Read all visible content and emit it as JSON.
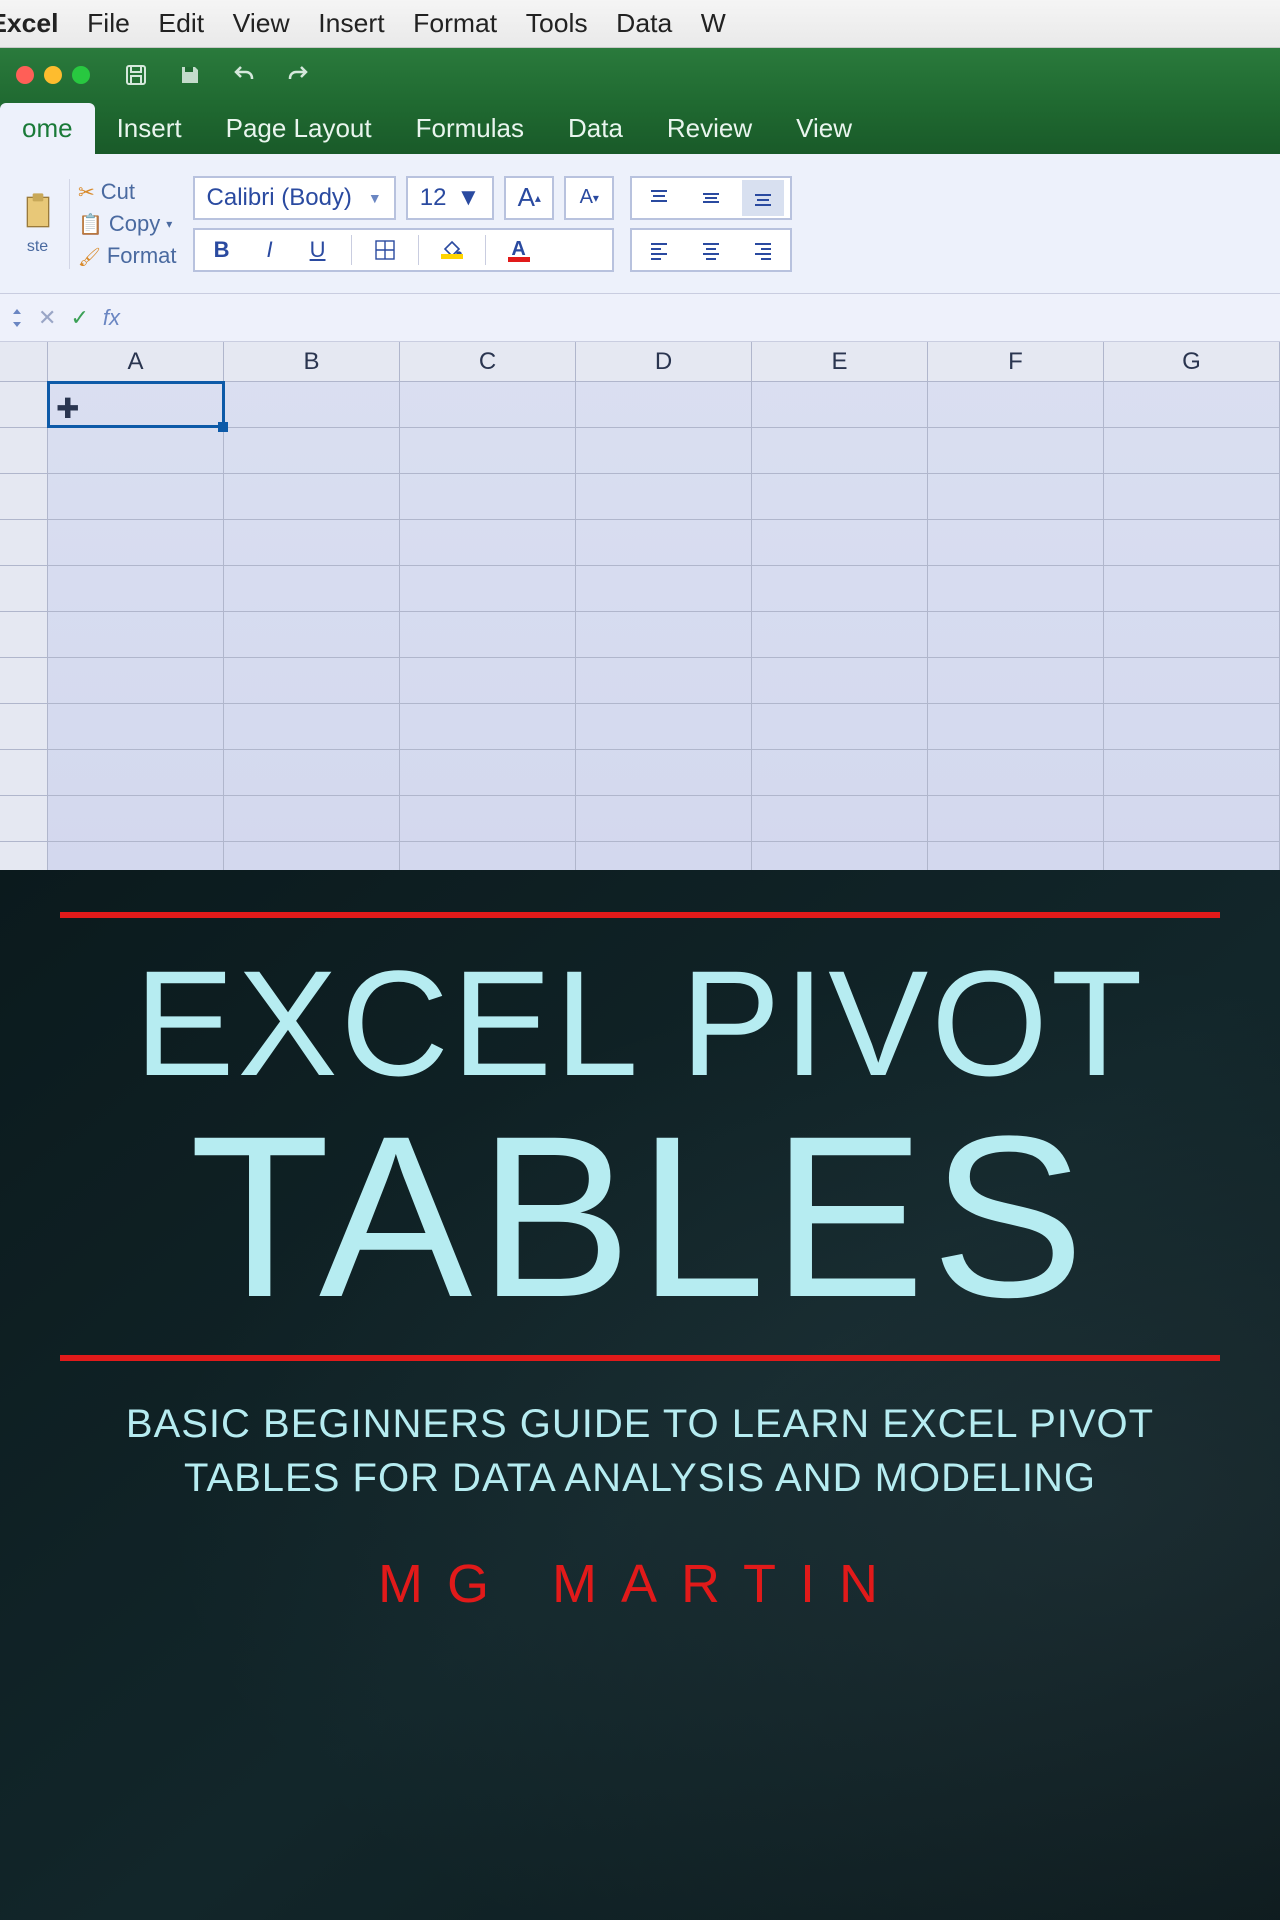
{
  "menubar": {
    "app": "Excel",
    "items": [
      "File",
      "Edit",
      "View",
      "Insert",
      "Format",
      "Tools",
      "Data",
      "W"
    ]
  },
  "ribbon_tabs": [
    "ome",
    "Insert",
    "Page Layout",
    "Formulas",
    "Data",
    "Review",
    "View"
  ],
  "clipboard": {
    "paste": "ste",
    "cut": "Cut",
    "copy": "Copy",
    "format": "Format"
  },
  "font_group": {
    "font_name": "Calibri (Body)",
    "font_size": "12",
    "bold": "B",
    "italic": "I",
    "underline": "U"
  },
  "formula_bar": {
    "fx": "fx"
  },
  "columns": [
    "A",
    "B",
    "C",
    "D",
    "E",
    "F",
    "G"
  ],
  "cover": {
    "title_line1": "EXCEL PIVOT",
    "title_line2": "TABLES",
    "subtitle": "BASIC BEGINNERS GUIDE TO LEARN EXCEL PIVOT TABLES FOR DATA ANALYSIS AND MODELING",
    "author": "MG MARTIN"
  }
}
